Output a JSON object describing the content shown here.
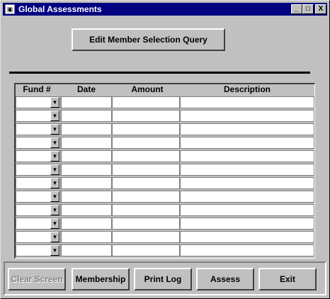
{
  "window": {
    "title": "Global Assessments"
  },
  "top_button": {
    "label": "Edit Member Selection Query"
  },
  "grid": {
    "columns": [
      "Fund #",
      "Date",
      "Amount",
      "Description"
    ],
    "row_count": 12
  },
  "buttons": {
    "clear": "Clear Screen",
    "membership": "Membership",
    "print_log": "Print Log",
    "assess": "Assess",
    "exit": "Exit"
  },
  "titlebar_buttons": {
    "minimize": "_",
    "maximize": "□",
    "close": "X"
  },
  "icons": {
    "system": "app-icon",
    "dropdown": "chevron-down-icon"
  }
}
